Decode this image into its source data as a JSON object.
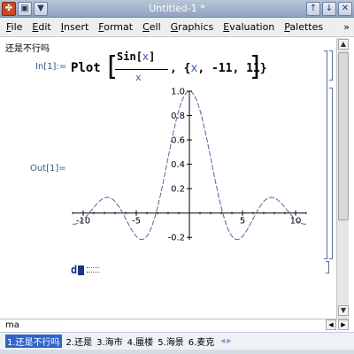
{
  "window": {
    "title": "Untitled-1 *",
    "left_buttons": [
      "✤",
      "▣",
      "▼"
    ],
    "right_buttons": [
      "↑",
      "↓",
      "✕"
    ]
  },
  "menu": {
    "items": [
      "File",
      "Edit",
      "Insert",
      "Format",
      "Cell",
      "Graphics",
      "Evaluation",
      "Palettes"
    ],
    "more": "»"
  },
  "document": {
    "header_text": "还是不行吗",
    "input_label": "In[1]:=",
    "output_label": "Out[1]=",
    "input": {
      "function": "Plot",
      "numerator_fn": "Sin",
      "numerator_open": "[",
      "numerator_var": "x",
      "numerator_close": "]",
      "denominator": "x",
      "range_open": ", {",
      "range_var": "x",
      "range_rest": ", -11, 11}"
    },
    "typing": "d"
  },
  "chart_data": {
    "type": "line",
    "function": "Sin[x]/x",
    "x_range": [
      -11,
      11
    ],
    "ylim": [
      -0.22,
      1.0
    ],
    "x_ticks": [
      -10,
      -5,
      5,
      10
    ],
    "x_tick_labels": [
      "-10",
      "-5",
      "5",
      "10"
    ],
    "y_ticks": [
      -0.2,
      0.2,
      0.4,
      0.6,
      0.8,
      1.0
    ],
    "y_tick_labels": [
      "-0.2",
      "0.2",
      "0.4",
      "0.6",
      "0.8",
      "1.0"
    ],
    "line_color": "#5a5f9c",
    "line_style": "dashed"
  },
  "status": {
    "input_text": "ma"
  },
  "ime": {
    "candidates": [
      "1.还是不行吗",
      "2.还是",
      "3.海市",
      "4.蜃楼",
      "5.海景",
      "6.麦克"
    ],
    "prev": "◂",
    "next": "▸"
  }
}
